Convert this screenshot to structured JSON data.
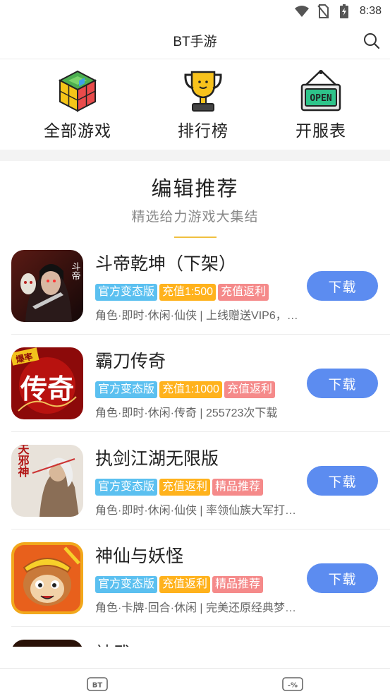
{
  "status_bar": {
    "time": "8:38",
    "icons": [
      "wifi-icon",
      "no-sim-icon",
      "battery-charging-icon"
    ]
  },
  "header": {
    "title": "BT手游",
    "search_icon": "search-icon"
  },
  "quick_nav": [
    {
      "label": "全部游戏",
      "icon": "rubik-cube-icon"
    },
    {
      "label": "排行榜",
      "icon": "trophy-icon"
    },
    {
      "label": "开服表",
      "icon": "open-sign-icon",
      "sign_text": "OPEN"
    }
  ],
  "section": {
    "title": "编辑推荐",
    "subtitle": "精选给力游戏大集结"
  },
  "games": [
    {
      "name": "斗帝乾坤（下架）",
      "tags": [
        {
          "text": "官方变态版",
          "color": "#5bc0f0"
        },
        {
          "text": "充值1:500",
          "color": "#ffb21c"
        },
        {
          "text": "充值返利",
          "color": "#f58a8a"
        }
      ],
      "desc": "角色·即时·休闲·仙侠 | 上线赠送VIP6，…",
      "button": "下载",
      "icon_text": "斗帝"
    },
    {
      "name": "霸刀传奇",
      "tags": [
        {
          "text": "官方变态版",
          "color": "#5bc0f0"
        },
        {
          "text": "充值1:1000",
          "color": "#ffb21c"
        },
        {
          "text": "充值返利",
          "color": "#f58a8a"
        }
      ],
      "desc": "角色·即时·休闲·传奇 | 255723次下载",
      "button": "下载",
      "icon_text": "传奇",
      "icon_badge": "爆率"
    },
    {
      "name": "执剑江湖无限版",
      "tags": [
        {
          "text": "官方变态版",
          "color": "#5bc0f0"
        },
        {
          "text": "充值返利",
          "color": "#ffb21c"
        },
        {
          "text": "精品推荐",
          "color": "#f58a8a"
        }
      ],
      "desc": "角色·即时·休闲·仙侠 | 率领仙族大军打…",
      "button": "下载",
      "icon_text": "逆天邪神"
    },
    {
      "name": "神仙与妖怪",
      "tags": [
        {
          "text": "官方变态版",
          "color": "#5bc0f0"
        },
        {
          "text": "充值返利",
          "color": "#ffb21c"
        },
        {
          "text": "精品推荐",
          "color": "#f58a8a"
        }
      ],
      "desc": "角色·卡牌·回合·休闲 | 完美还原经典梦…",
      "button": "下载"
    },
    {
      "name": "神武",
      "tags": [],
      "desc": "",
      "button": ""
    }
  ],
  "tab_bar": [
    {
      "label": "BT",
      "icon": "bt-tab-icon"
    },
    {
      "label": "-%",
      "icon": "discount-tab-icon"
    }
  ],
  "colors": {
    "accent_blue": "#5c8cf0",
    "tag_blue": "#5bc0f0",
    "tag_orange": "#ffb21c",
    "tag_pink": "#f58a8a",
    "section_line": "#f0c040"
  }
}
